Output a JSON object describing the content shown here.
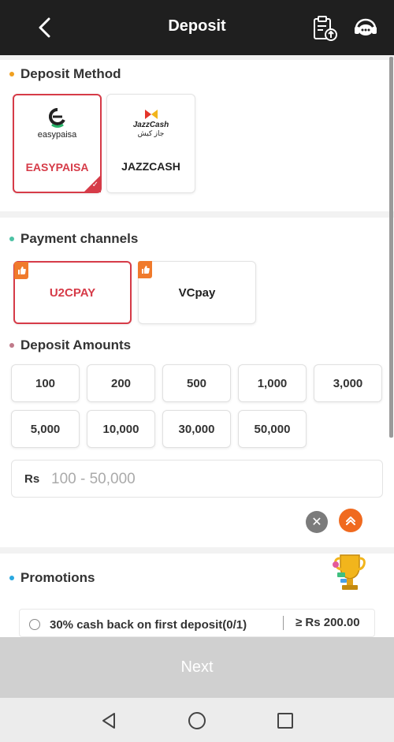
{
  "header": {
    "title": "Deposit"
  },
  "deposit_method": {
    "title": "Deposit Method",
    "methods": [
      {
        "label": "EASYPAISA",
        "logo_text": "easypaisa",
        "selected": true
      },
      {
        "label": "JAZZCASH",
        "logo_text": "JazzCash",
        "logo_subtext": "جاز کیش",
        "selected": false
      }
    ]
  },
  "payment_channels": {
    "title": "Payment channels",
    "channels": [
      {
        "label": "U2CPAY",
        "selected": true
      },
      {
        "label": "VCpay",
        "selected": false
      }
    ]
  },
  "deposit_amounts": {
    "title": "Deposit Amounts",
    "amounts": [
      "100",
      "200",
      "500",
      "1,000",
      "3,000",
      "5,000",
      "10,000",
      "30,000",
      "50,000"
    ],
    "currency": "Rs",
    "placeholder": "100 - 50,000"
  },
  "promotions": {
    "title": "Promotions",
    "items": [
      {
        "text": "30% cash back on first deposit(0/1)",
        "amount": "≥ Rs 200.00"
      }
    ]
  },
  "footer": {
    "next_label": "Next"
  },
  "colors": {
    "accent": "#d63b48",
    "header_bg": "#1f1f1f",
    "orange": "#f06a1f"
  }
}
